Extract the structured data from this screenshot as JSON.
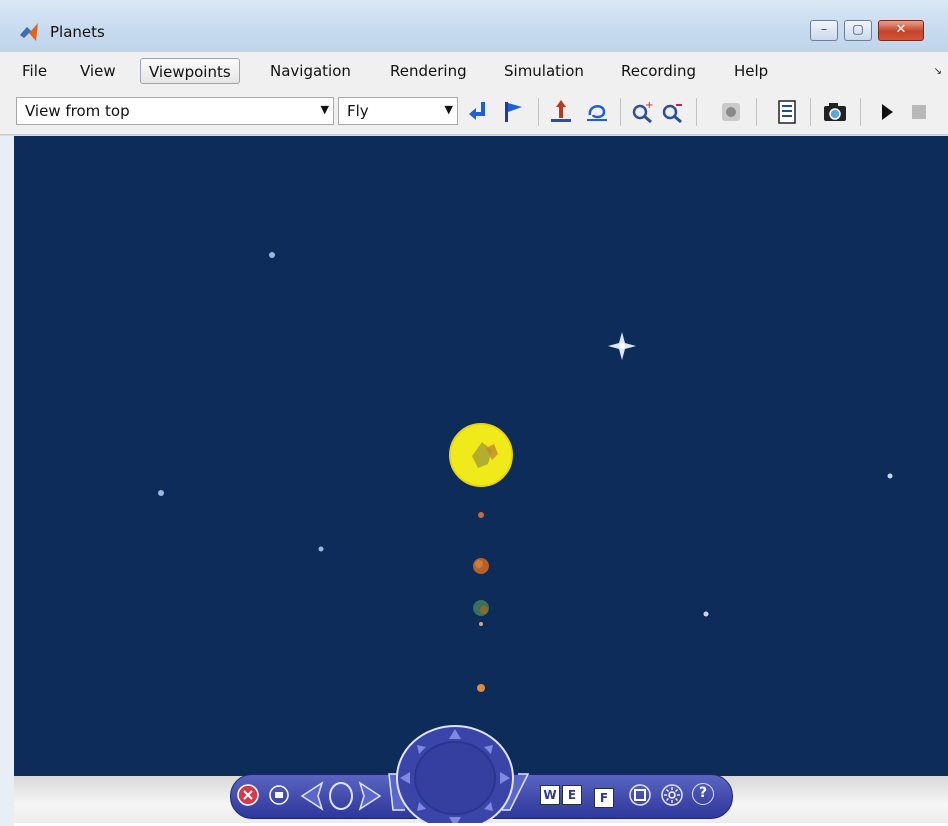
{
  "window": {
    "title": "Planets",
    "controls": {
      "minimize": "–",
      "maximize": "▢",
      "close": "✕"
    }
  },
  "menubar": {
    "items": [
      {
        "label": "File"
      },
      {
        "label": "View"
      },
      {
        "label": "Viewpoints",
        "active": true
      },
      {
        "label": "Navigation"
      },
      {
        "label": "Rendering"
      },
      {
        "label": "Simulation"
      },
      {
        "label": "Recording"
      },
      {
        "label": "Help"
      }
    ],
    "more_icon": "chevron-more-icon"
  },
  "toolbar": {
    "viewpoint_select": {
      "value": "View from top"
    },
    "navmode_select": {
      "value": "Fly"
    },
    "icons": [
      "return-icon",
      "flag-icon",
      "straighten-up-icon",
      "undo-move-icon",
      "zoom-in-icon",
      "zoom-out-icon",
      "record-icon",
      "properties-icon",
      "camera-icon",
      "play-icon",
      "stop-icon"
    ]
  },
  "navigation_panel": {
    "letters": {
      "w": "W",
      "e": "E",
      "f": "F"
    },
    "help": "?",
    "icons": [
      "close-icon",
      "minimize-icon",
      "turn-left-icon",
      "rotate-icon",
      "turn-right-icon",
      "compass-wheel-icon",
      "wireframe-icon",
      "headlight-icon",
      "help-icon"
    ]
  },
  "colors": {
    "sky": "#0e2c59",
    "sun": "#f1ea1a",
    "panel": "#3f48ad",
    "titlebar": "#c8dbef"
  }
}
